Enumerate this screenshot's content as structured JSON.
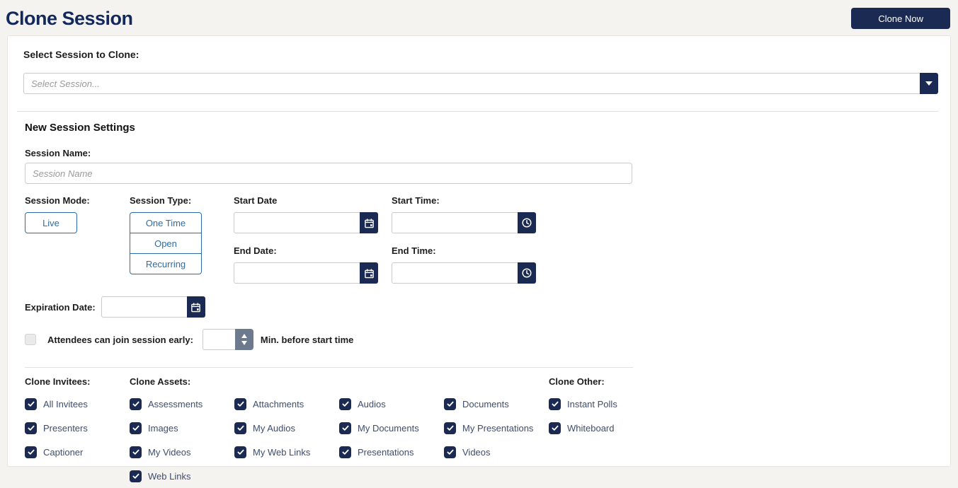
{
  "page": {
    "title": "Clone Session"
  },
  "header": {
    "clone_now_label": "Clone Now"
  },
  "colors": {
    "navy": "#1b2a52",
    "outline_blue": "#2d6da3",
    "title_navy": "#14295b",
    "stepper_gray": "#6d7a8e",
    "checkbox_label": "#3e4d6d"
  },
  "select_section": {
    "label": "Select Session to Clone:",
    "placeholder": "Select Session...",
    "value": ""
  },
  "settings": {
    "heading": "New Session Settings",
    "session_name_label": "Session Name:",
    "session_name_placeholder": "Session Name",
    "session_name_value": "",
    "session_mode_label": "Session Mode:",
    "session_mode_value": "Live",
    "session_type_label": "Session Type:",
    "session_type_options": [
      "One Time",
      "Open",
      "Recurring"
    ],
    "start_date_label": "Start Date",
    "start_date_value": "",
    "start_time_label": "Start Time:",
    "start_time_value": "",
    "end_date_label": "End Date:",
    "end_date_value": "",
    "end_time_label": "End Time:",
    "end_time_value": "",
    "expiration_date_label": "Expiration Date:",
    "expiration_date_value": "",
    "attendees_checkbox_label": "Attendees can join session early:",
    "attendees_checkbox_checked": false,
    "minutes_value": "",
    "attendees_suffix": "Min. before start time"
  },
  "clone_options": {
    "columns": [
      {
        "header": "Clone Invitees:",
        "items": [
          {
            "label": "All Invitees",
            "checked": true
          },
          {
            "label": "Presenters",
            "checked": true
          },
          {
            "label": "Captioner",
            "checked": true
          }
        ]
      },
      {
        "header": "Clone Assets:",
        "items": [
          {
            "label": "Assessments",
            "checked": true
          },
          {
            "label": "Images",
            "checked": true
          },
          {
            "label": "My Videos",
            "checked": true
          },
          {
            "label": "Web Links",
            "checked": true
          }
        ]
      },
      {
        "header": "",
        "items": [
          {
            "label": "Attachments",
            "checked": true
          },
          {
            "label": "My Audios",
            "checked": true
          },
          {
            "label": "My Web Links",
            "checked": true
          }
        ]
      },
      {
        "header": "",
        "items": [
          {
            "label": "Audios",
            "checked": true
          },
          {
            "label": "My Documents",
            "checked": true
          },
          {
            "label": "Presentations",
            "checked": true
          }
        ]
      },
      {
        "header": "",
        "items": [
          {
            "label": "Documents",
            "checked": true
          },
          {
            "label": "My Presentations",
            "checked": true
          },
          {
            "label": "Videos",
            "checked": true
          }
        ]
      },
      {
        "header": "Clone Other:",
        "items": [
          {
            "label": "Instant Polls",
            "checked": true
          },
          {
            "label": "Whiteboard",
            "checked": true
          }
        ]
      }
    ]
  }
}
